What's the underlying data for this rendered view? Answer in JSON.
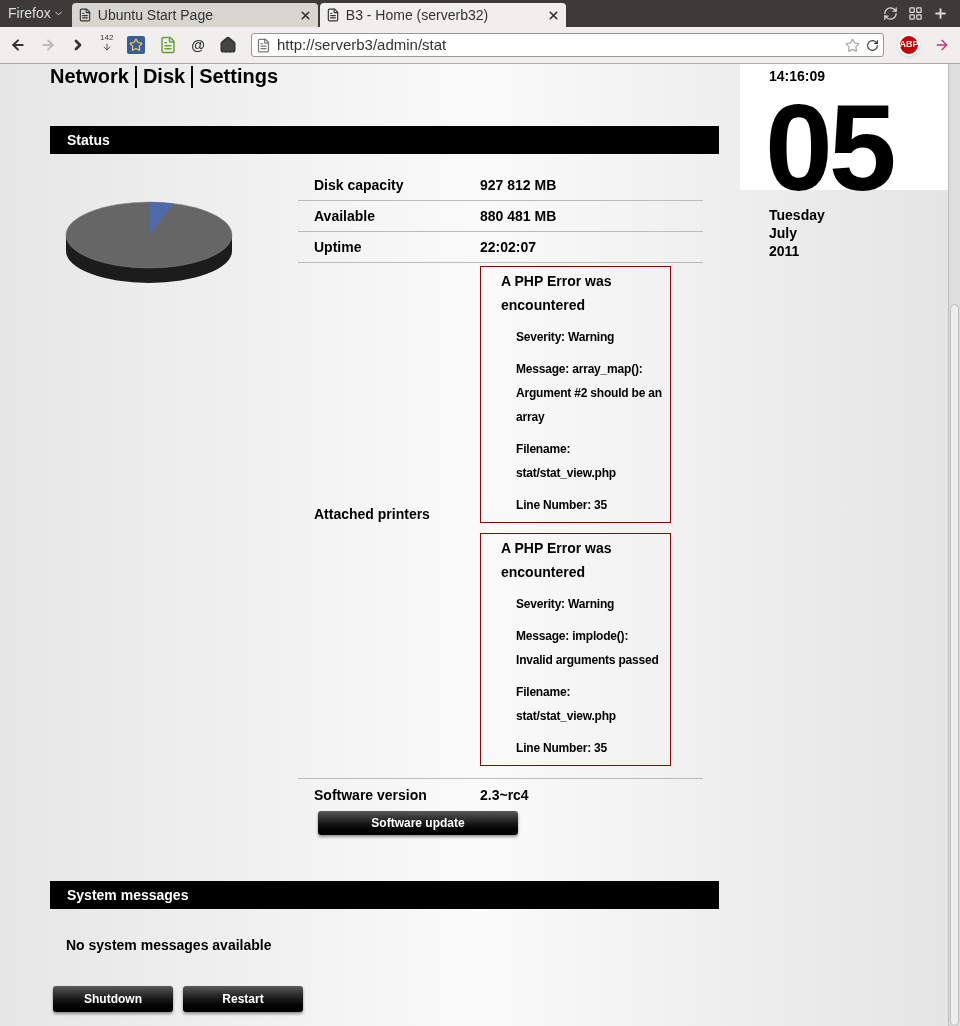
{
  "browser": {
    "app_menu": "Firefox",
    "tabs": [
      {
        "title": "Ubuntu Start Page",
        "selected": false
      },
      {
        "title": "B3 - Home (serverb32)",
        "selected": true
      }
    ],
    "download_count": "142",
    "mail_button": "@",
    "url": "http://serverb3/admin/stat",
    "adblock_badge": "ABP"
  },
  "nav": [
    "Network",
    "Disk",
    "Settings"
  ],
  "clock": {
    "time": "14:16:09",
    "day": "05",
    "weekday": "Tuesday",
    "month": "July",
    "year": "2011"
  },
  "status": {
    "title": "Status",
    "rows": [
      {
        "kind": "text",
        "label": "Disk capacity",
        "value": "927 812 MB"
      },
      {
        "kind": "text",
        "label": "Available",
        "value": "880 481 MB"
      },
      {
        "kind": "text",
        "label": "Uptime",
        "value": "22:02:07"
      },
      {
        "kind": "errors",
        "label": "Attached printers",
        "errors": [
          {
            "title": "A PHP Error was encountered",
            "lines": [
              "Severity: Warning",
              "Message: array_map(): Argument #2 should be an array",
              "Filename: stat/stat_view.php",
              "Line Number: 35"
            ]
          },
          {
            "title": "A PHP Error was encountered",
            "lines": [
              "Severity: Warning",
              "Message: implode(): Invalid arguments passed",
              "Filename: stat/stat_view.php",
              "Line Number: 35"
            ]
          }
        ]
      },
      {
        "kind": "version",
        "label": "Software version",
        "value": "2.3~rc4",
        "button": "Software update"
      }
    ]
  },
  "system_messages": {
    "title": "System messages",
    "message": "No system messages available",
    "buttons": [
      "Shutdown",
      "Restart"
    ]
  }
}
